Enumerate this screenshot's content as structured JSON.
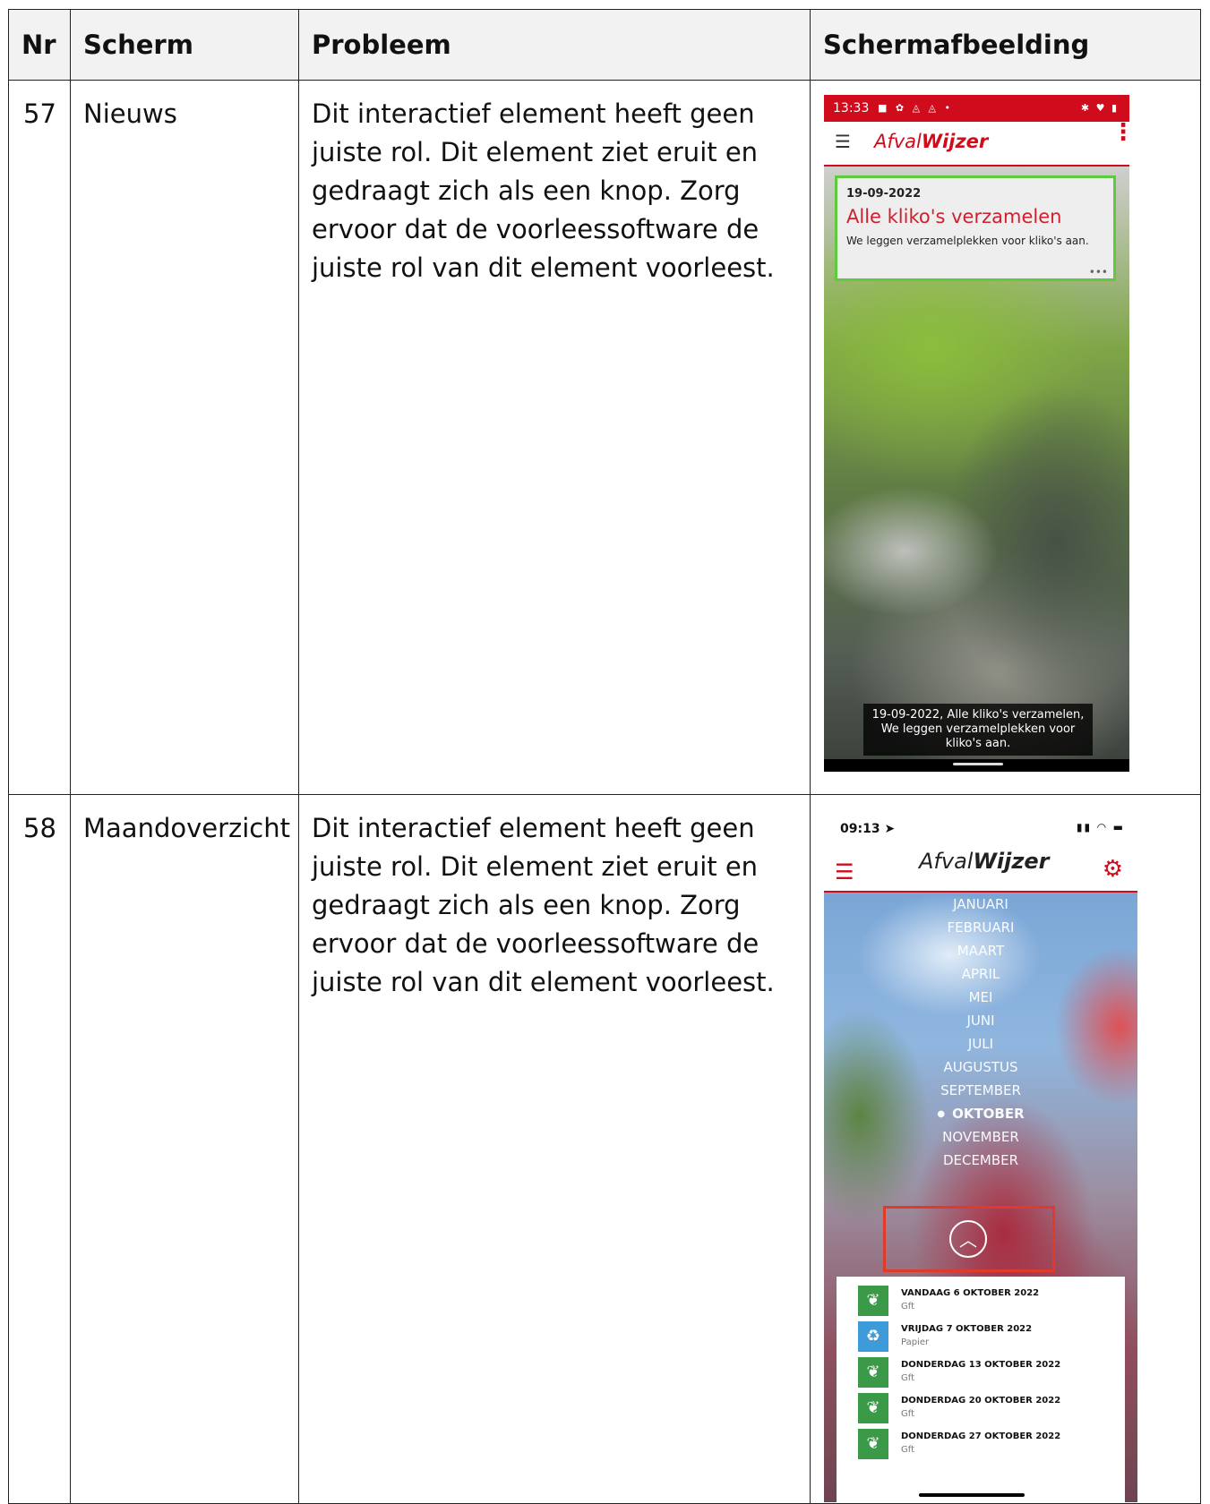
{
  "table": {
    "headers": [
      "Nr",
      "Scherm",
      "Probleem",
      "Schermafbeelding"
    ],
    "rows": [
      {
        "nr": "57",
        "scherm": "Nieuws",
        "probleem": "Dit interactief element heeft geen juiste rol. Dit element ziet eruit en gedraagt zich als een knop. Zorg ervoor dat de voorleessoftware de juiste rol van dit element voorleest."
      },
      {
        "nr": "58",
        "scherm": "Maandoverzicht",
        "probleem": "Dit interactief element heeft geen juiste rol. Dit element ziet eruit en gedraagt zich als een knop. Zorg ervoor dat de voorleessoftware de juiste rol van dit element voorleest."
      }
    ]
  },
  "shot1": {
    "status_time": "13:33",
    "logo_light": "Afval",
    "logo_bold": "Wijzer",
    "card": {
      "date": "19-09-2022",
      "title": "Alle kliko's verzamelen",
      "description": "We leggen verzamelplekken voor kliko's aan.",
      "more": "•••"
    },
    "caption": "19-09-2022, Alle kliko's verzamelen, We leggen verzamelplekken voor kliko's aan.",
    "icons": [
      "menu-icon",
      "more-vertical-icon"
    ],
    "colors": {
      "brand": "#d00b1b",
      "focus": "#5fc93f"
    }
  },
  "shot2": {
    "status_time": "09:13",
    "logo_light": "Afval",
    "logo_bold": "Wijzer",
    "months": [
      "JANUARI",
      "FEBRUARI",
      "MAART",
      "APRIL",
      "MEI",
      "JUNI",
      "JULI",
      "AUGUSTUS",
      "SEPTEMBER",
      "OKTOBER",
      "NOVEMBER",
      "DECEMBER"
    ],
    "active_month": "OKTOBER",
    "collections": [
      {
        "date": "VANDAAG 6 OKTOBER 2022",
        "type": "Gft",
        "icon": "gft-icon"
      },
      {
        "date": "VRIJDAG 7 OKTOBER 2022",
        "type": "Papier",
        "icon": "papier-icon"
      },
      {
        "date": "DONDERDAG 13 OKTOBER 2022",
        "type": "Gft",
        "icon": "gft-icon"
      },
      {
        "date": "DONDERDAG 20 OKTOBER 2022",
        "type": "Gft",
        "icon": "gft-icon"
      },
      {
        "date": "DONDERDAG 27 OKTOBER 2022",
        "type": "Gft",
        "icon": "gft-icon"
      }
    ],
    "icons": [
      "menu-icon",
      "gear-icon",
      "chevron-up-icon"
    ],
    "colors": {
      "brand": "#d00b1b",
      "highlight": "#e03a2a",
      "gft": "#3b9a47",
      "papier": "#3d9bd9"
    }
  }
}
